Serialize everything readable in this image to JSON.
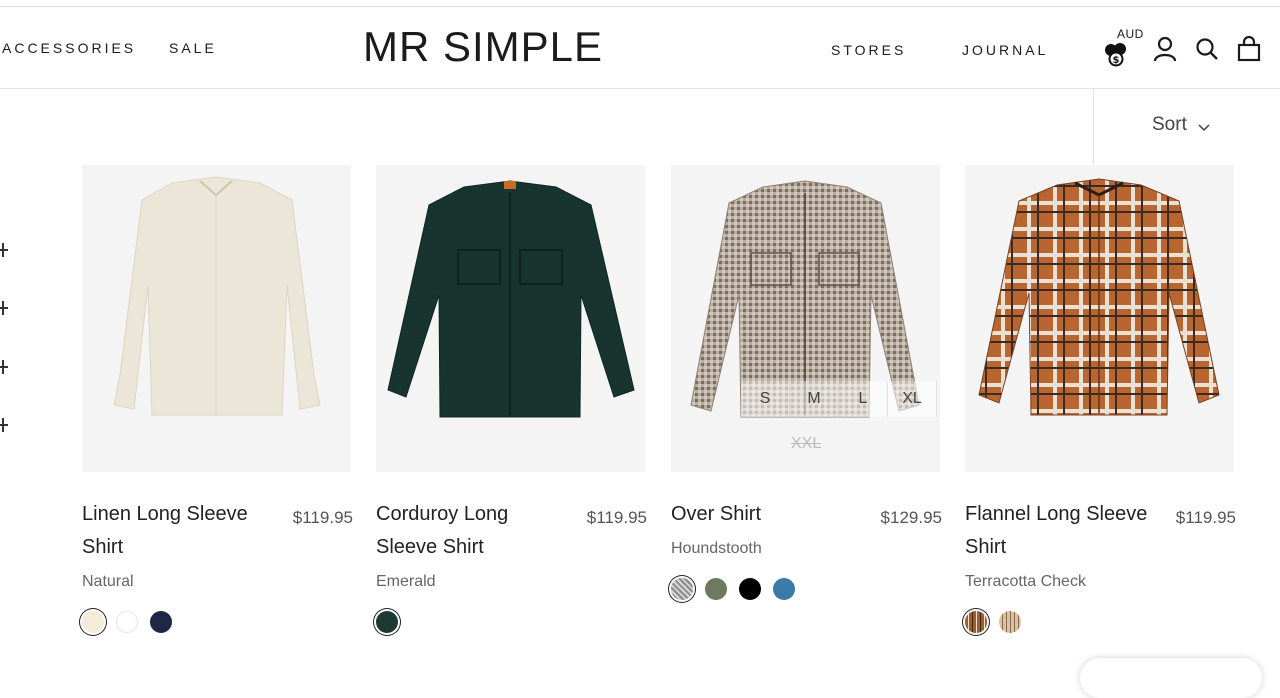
{
  "nav": {
    "left": [
      "ACCESSORIES",
      "SALE"
    ],
    "logo": "MR SIMPLE",
    "right": [
      "STORES",
      "JOURNAL"
    ],
    "currency": "AUD"
  },
  "sort": {
    "label": "Sort"
  },
  "products": [
    {
      "name": "Linen Long Sleeve Shirt",
      "price": "$119.95",
      "variant": "Natural",
      "swatches": [
        "#f3ecd9",
        "#ffffff",
        "#1f2744"
      ],
      "selected": 0
    },
    {
      "name": "Corduroy Long Sleeve Shirt",
      "price": "$119.95",
      "variant": "Emerald",
      "swatches": [
        "#1c3a33"
      ],
      "selected": 0
    },
    {
      "name": "Over Shirt",
      "price": "$129.95",
      "variant": "Houndstooth",
      "swatches": [
        "#b9b9b9",
        "#6e7a5d",
        "#000000",
        "#3a7aa8"
      ],
      "selected": 0,
      "sizes": [
        "S",
        "M",
        "L",
        "XL"
      ],
      "soldout_size": "XXL"
    },
    {
      "name": "Flannel Long Sleeve Shirt",
      "price": "$119.95",
      "variant": "Terracotta Check",
      "swatches": [
        "#a8592b",
        "#d8c2a3"
      ],
      "selected": 0
    }
  ],
  "colors": {
    "accent": "#1c1b1b",
    "image_bg": "#f4f4f4"
  },
  "icons": [
    "currency-coins-icon",
    "account-icon",
    "search-icon",
    "cart-bag-icon",
    "chevron-down-icon",
    "plus-icon"
  ]
}
